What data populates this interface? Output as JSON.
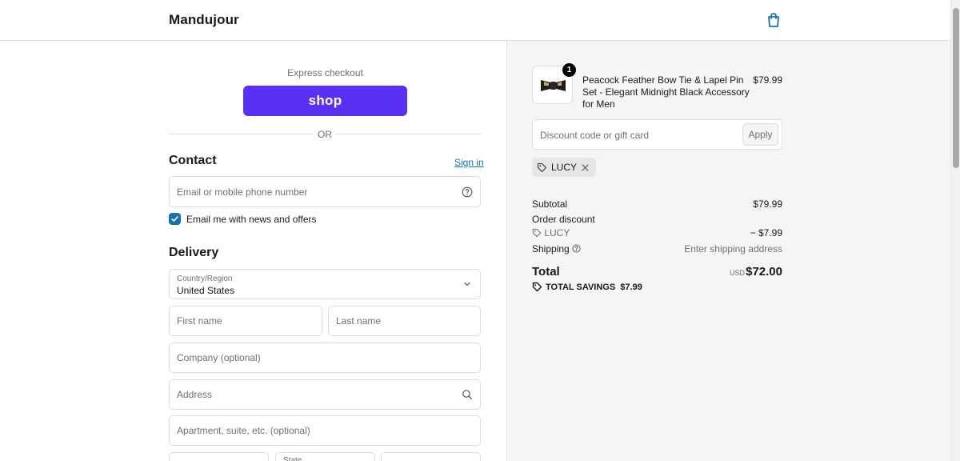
{
  "header": {
    "brand": "Mandujour",
    "cart_icon": "shopping-bag-icon"
  },
  "express": {
    "label": "Express checkout",
    "shop_button": "shop",
    "divider": "OR"
  },
  "contact": {
    "title": "Contact",
    "signin": "Sign in",
    "email_placeholder": "Email or mobile phone number",
    "newsletter_label": "Email me with news and offers",
    "newsletter_checked": true
  },
  "delivery": {
    "title": "Delivery",
    "country_label": "Country/Region",
    "country_value": "United States",
    "first_name": "First name",
    "last_name": "Last name",
    "company": "Company (optional)",
    "address": "Address",
    "apartment": "Apartment, suite, etc. (optional)",
    "state": "State"
  },
  "summary": {
    "item": {
      "quantity": "1",
      "title": "Peacock Feather Bow Tie & Lapel Pin Set - Elegant Midnight Black Accessory for Men",
      "price": "$79.99"
    },
    "discount_placeholder": "Discount code or gift card",
    "apply": "Apply",
    "applied_code": "LUCY",
    "subtotal_label": "Subtotal",
    "subtotal_value": "$79.99",
    "order_discount_label": "Order discount",
    "discount_code": "LUCY",
    "discount_value": "− $7.99",
    "shipping_label": "Shipping",
    "shipping_value": "Enter shipping address",
    "total_label": "Total",
    "currency": "USD",
    "total_value": "$72.00",
    "savings": "TOTAL SAVINGS  $7.99"
  },
  "colors": {
    "accent": "#1773b0",
    "shop": "#5a31f4",
    "summary_bg": "#f5f5f5"
  }
}
